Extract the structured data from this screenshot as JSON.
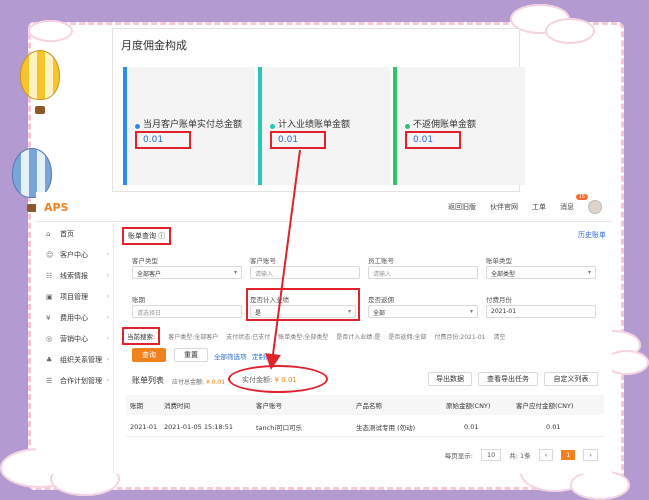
{
  "commission": {
    "title": "月度佣金构成",
    "cards": [
      {
        "label": "当月客户账单实付总金额",
        "value": "0.01"
      },
      {
        "label": "计入业绩账单金额",
        "value": "0.01"
      },
      {
        "label": "不返佣账单金额",
        "value": "0.01"
      }
    ]
  },
  "app": {
    "logo": "APS",
    "header_links": [
      "返回旧版",
      "伙伴官网",
      "工单",
      "消息"
    ],
    "message_badge": "15",
    "sidebar": [
      {
        "icon": "⌂",
        "label": "首页",
        "has_arrow": false
      },
      {
        "icon": "☺",
        "label": "客户中心",
        "has_arrow": true
      },
      {
        "icon": "☷",
        "label": "线索情报",
        "has_arrow": true
      },
      {
        "icon": "▣",
        "label": "项目管理",
        "has_arrow": true
      },
      {
        "icon": "¥",
        "label": "费用中心",
        "has_arrow": true
      },
      {
        "icon": "◎",
        "label": "营销中心",
        "has_arrow": true
      },
      {
        "icon": "♣",
        "label": "组织关系管理",
        "has_arrow": true
      },
      {
        "icon": "☰",
        "label": "合作计划管理",
        "has_arrow": true
      }
    ],
    "breadcrumb": "账单查询 ⓘ",
    "history_link": "历史账单",
    "filters": {
      "customer_type_label": "客户类型",
      "customer_type_value": "全部客户",
      "customer_account_label": "客户账号",
      "customer_account_placeholder": "请输入",
      "staff_account_label": "员工账号",
      "staff_account_placeholder": "请输入",
      "bill_type_label": "账单类型",
      "bill_type_value": "全部类型",
      "period_label": "账期",
      "period_placeholder": "请选择日",
      "in_perf_label": "是否计入业绩",
      "in_perf_value": "是",
      "no_rebate_label": "是否返佣",
      "no_rebate_value": "全部",
      "pay_month_label": "付费月份",
      "pay_month_value": "2021-01"
    },
    "current_search_label": "当前搜索:",
    "current_tags": [
      "客户类型:全部客户",
      "支付状态:已支付",
      "账单类型:全部类型",
      "是否计入业绩:是",
      "是否返佣:全部",
      "付费月份:2021-01",
      "清空"
    ],
    "buttons": {
      "search": "查询",
      "reset": "重置"
    },
    "links": {
      "all_filter": "全部筛选项",
      "custom_filter": "定制筛选"
    },
    "list": {
      "title": "账单列表",
      "payable_label": "应付总金额:",
      "payable_value": "¥ 0.01",
      "paid_label": "实付金额:",
      "paid_value": "¥ 0.01",
      "actions": [
        "导出数据",
        "查看导出任务",
        "自定义列表"
      ],
      "columns": [
        "账期",
        "消费时间",
        "客户账号",
        "产品名称",
        "原始金额(CNY)",
        "客户应付金额(CNY)"
      ],
      "rows": [
        [
          "2021-01",
          "2021-01-05 15:18:51",
          "tanchi可口可乐",
          "生态测试专用 (勿动)",
          "0.01",
          "0.01"
        ]
      ]
    },
    "pager": {
      "per_page_label": "每页显示:",
      "per_page": "10",
      "total": "共: 1条",
      "current": "1"
    }
  }
}
